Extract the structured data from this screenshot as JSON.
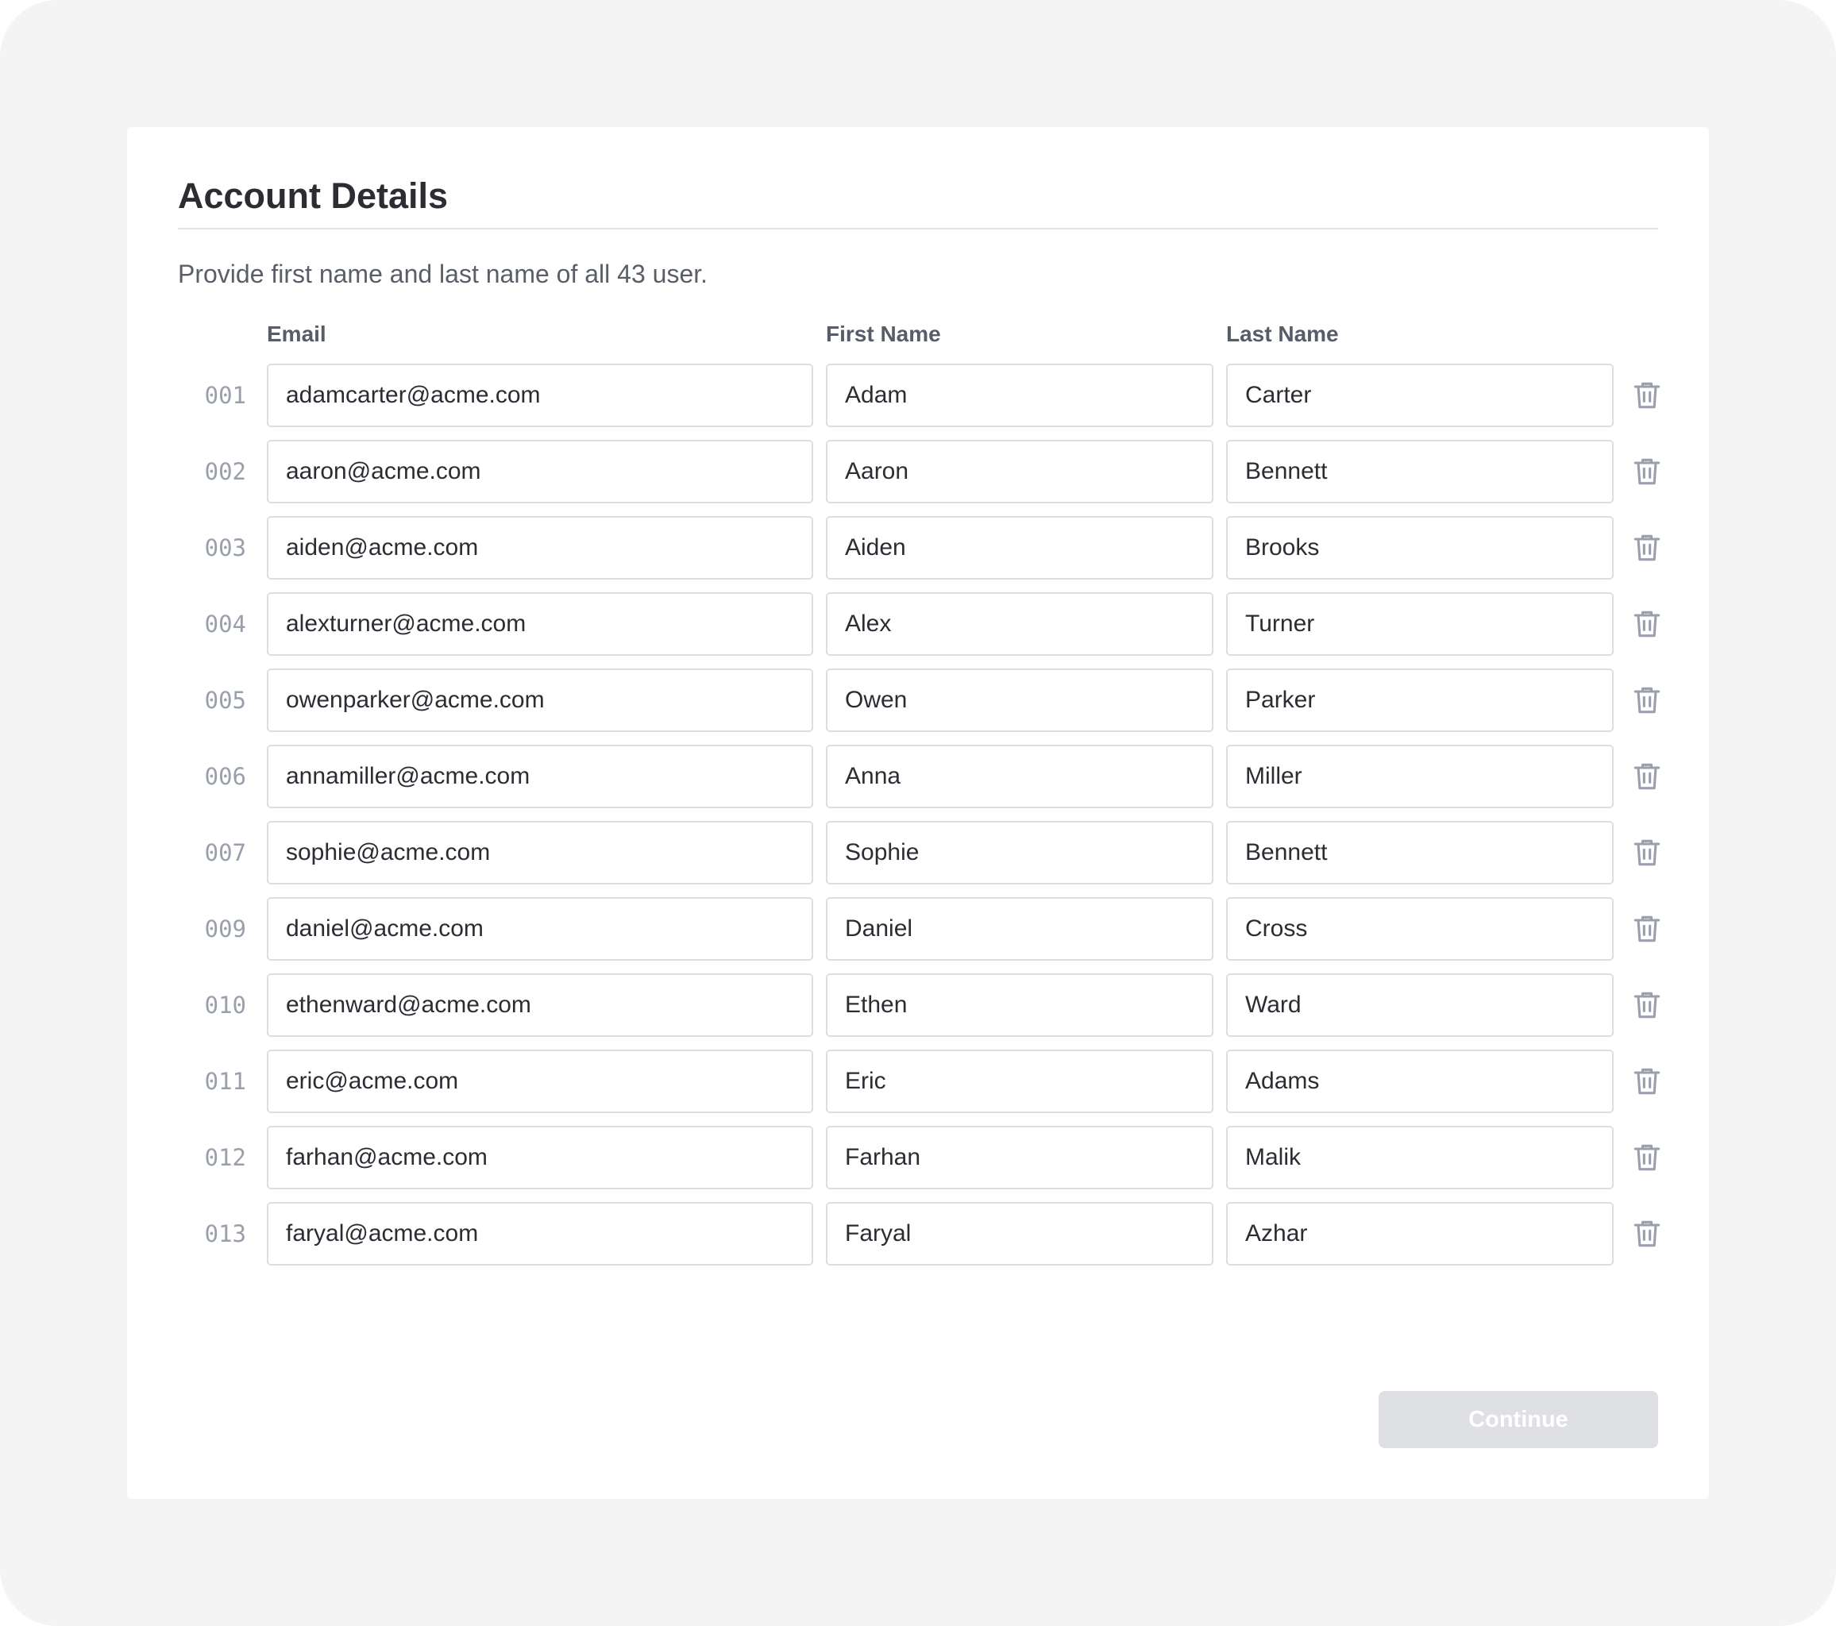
{
  "form": {
    "title": "Account Details",
    "subtitle": "Provide first name and last name of all 43 user.",
    "columns": {
      "email": "Email",
      "first_name": "First Name",
      "last_name": "Last Name"
    },
    "rows": [
      {
        "num": "001",
        "email": "adamcarter@acme.com",
        "first": "Adam",
        "last": "Carter"
      },
      {
        "num": "002",
        "email": "aaron@acme.com",
        "first": "Aaron",
        "last": "Bennett"
      },
      {
        "num": "003",
        "email": "aiden@acme.com",
        "first": "Aiden",
        "last": "Brooks"
      },
      {
        "num": "004",
        "email": "alexturner@acme.com",
        "first": "Alex",
        "last": "Turner"
      },
      {
        "num": "005",
        "email": "owenparker@acme.com",
        "first": "Owen",
        "last": "Parker"
      },
      {
        "num": "006",
        "email": "annamiller@acme.com",
        "first": "Anna",
        "last": "Miller"
      },
      {
        "num": "007",
        "email": "sophie@acme.com",
        "first": "Sophie",
        "last": "Bennett"
      },
      {
        "num": "009",
        "email": "daniel@acme.com",
        "first": "Daniel",
        "last": "Cross"
      },
      {
        "num": "010",
        "email": "ethenward@acme.com",
        "first": "Ethen",
        "last": "Ward"
      },
      {
        "num": "011",
        "email": "eric@acme.com",
        "first": "Eric",
        "last": "Adams"
      },
      {
        "num": "012",
        "email": "farhan@acme.com",
        "first": "Farhan",
        "last": "Malik"
      },
      {
        "num": "013",
        "email": "faryal@acme.com",
        "first": "Faryal",
        "last": "Azhar"
      }
    ],
    "row_action_icon": "trash-icon",
    "continue_label": "Continue"
  },
  "colors": {
    "page_background": "#f4f4f5",
    "card_background": "#ffffff",
    "field_border": "#dcdde0",
    "text_primary": "#2b2d33",
    "text_muted": "#9aa0ab",
    "button_disabled": "#dfe0e3"
  }
}
